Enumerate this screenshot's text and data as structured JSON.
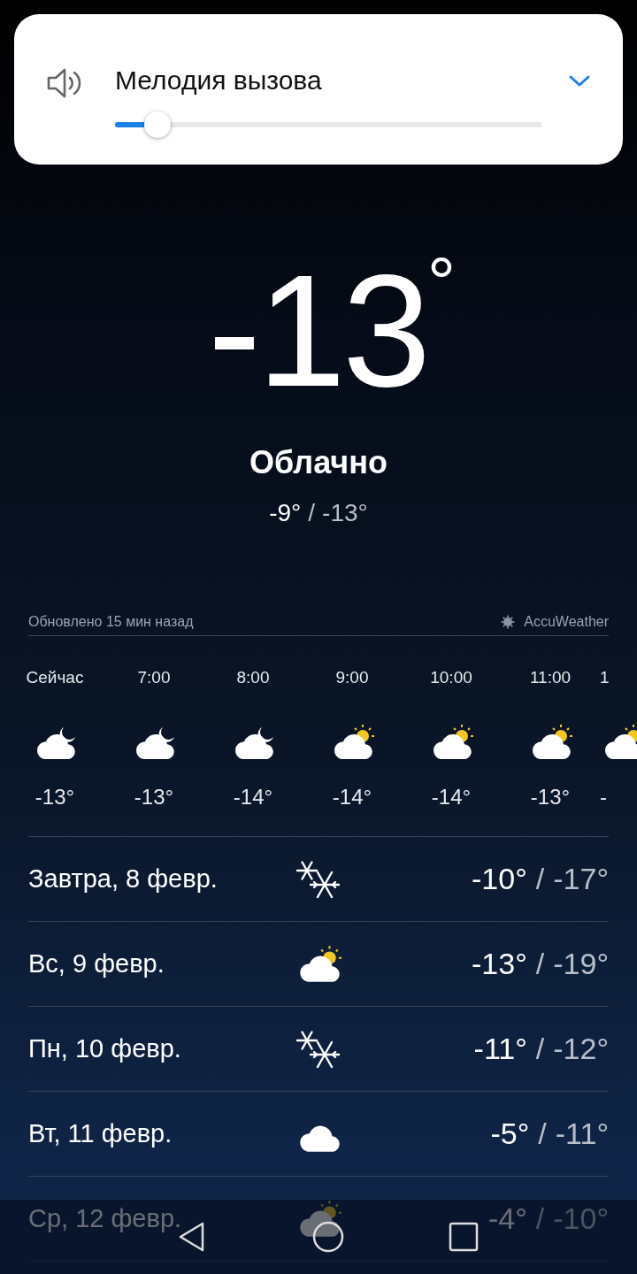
{
  "volume_panel": {
    "title": "Мелодия вызова",
    "level": 0.08
  },
  "current": {
    "temperature": "-13",
    "degree": "°",
    "condition": "Облачно",
    "high": "-9°",
    "separator": "/",
    "low": "-13°"
  },
  "source": {
    "updated": "Обновлено 15 мин назад",
    "provider": "AccuWeather"
  },
  "hourly": [
    {
      "time": "Сейчас",
      "kind": "night",
      "temp": "-13°"
    },
    {
      "time": "7:00",
      "kind": "night",
      "temp": "-13°"
    },
    {
      "time": "8:00",
      "kind": "night",
      "temp": "-14°"
    },
    {
      "time": "9:00",
      "kind": "sunny",
      "temp": "-14°"
    },
    {
      "time": "10:00",
      "kind": "sunny",
      "temp": "-14°"
    },
    {
      "time": "11:00",
      "kind": "sunny",
      "temp": "-13°"
    },
    {
      "time": "1",
      "kind": "sunny",
      "temp": "-"
    }
  ],
  "daily": [
    {
      "day": "Завтра, 8 февр.",
      "kind": "snow",
      "high": "-10°",
      "low": "-17°"
    },
    {
      "day": "Вс, 9 февр.",
      "kind": "sunny",
      "high": "-13°",
      "low": "-19°"
    },
    {
      "day": "Пн, 10 февр.",
      "kind": "snow",
      "high": "-11°",
      "low": "-12°"
    },
    {
      "day": "Вт, 11 февр.",
      "kind": "cloudy",
      "high": "-5°",
      "low": "-11°"
    },
    {
      "day": "Ср, 12 февр.",
      "kind": "sunny",
      "high": "-4°",
      "low": "-10°"
    }
  ],
  "separator": "/"
}
